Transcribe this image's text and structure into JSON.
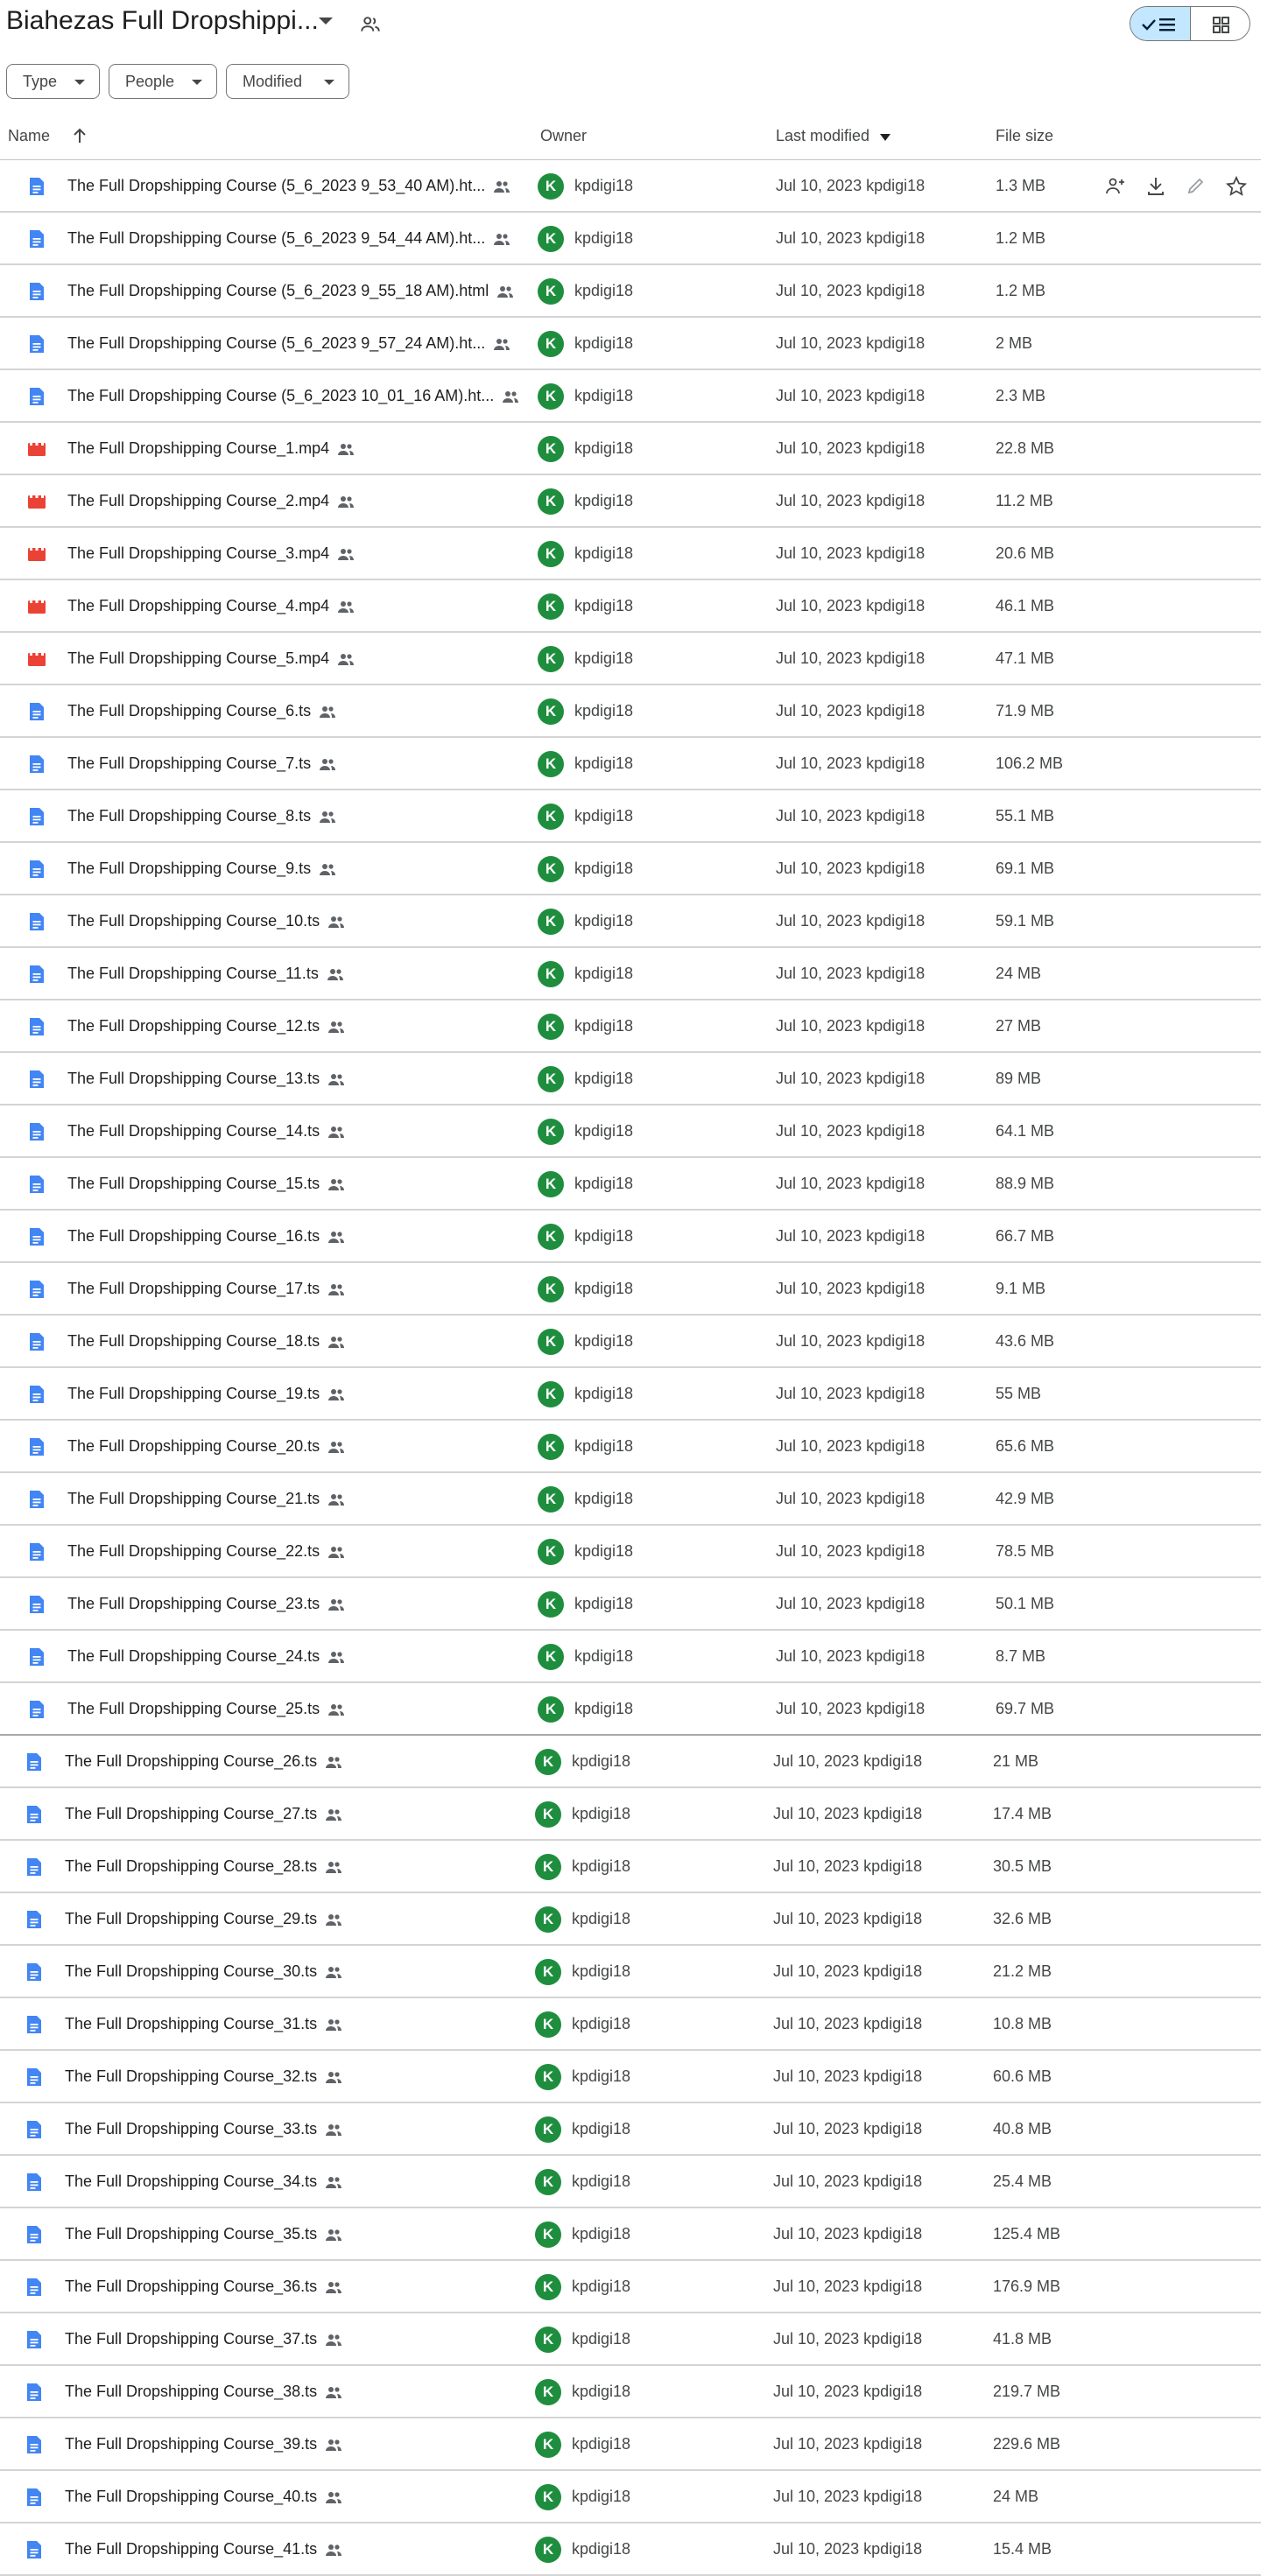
{
  "header": {
    "title": "Biahezas Full Dropshippi...",
    "icons": {
      "title_menu": "chevron-down-icon",
      "shared": "people-icon",
      "list_view": "checkmark-list-icon",
      "grid_view": "grid-icon"
    }
  },
  "filters": [
    {
      "label": "Type"
    },
    {
      "label": "People"
    },
    {
      "label": "Modified"
    }
  ],
  "columns": {
    "name": "Name",
    "owner": "Owner",
    "last_modified": "Last modified",
    "file_size": "File size",
    "sort_icon": "arrow-up-icon",
    "sort_caret": "caret-down-icon"
  },
  "row_actions": [
    "share-add-icon",
    "download-icon",
    "rename-icon",
    "star-icon"
  ],
  "colors": {
    "doc_icon": "#4285f4",
    "video_icon": "#ea4335",
    "avatar": "#1e8e3e",
    "selected_toggle": "#c2e7ff"
  },
  "files": [
    {
      "name": "The Full Dropshipping Course (5_6_2023 9_53_40 AM).ht...",
      "type": "doc",
      "avatar": "K",
      "owner": "kpdigi18",
      "modified": "Jul 10, 2023 kpdigi18",
      "size": "1.3 MB"
    },
    {
      "name": "The Full Dropshipping Course (5_6_2023 9_54_44 AM).ht...",
      "type": "doc",
      "avatar": "K",
      "owner": "kpdigi18",
      "modified": "Jul 10, 2023 kpdigi18",
      "size": "1.2 MB"
    },
    {
      "name": "The Full Dropshipping Course (5_6_2023 9_55_18 AM).html",
      "type": "doc",
      "avatar": "K",
      "owner": "kpdigi18",
      "modified": "Jul 10, 2023 kpdigi18",
      "size": "1.2 MB"
    },
    {
      "name": "The Full Dropshipping Course (5_6_2023 9_57_24 AM).ht...",
      "type": "doc",
      "avatar": "K",
      "owner": "kpdigi18",
      "modified": "Jul 10, 2023 kpdigi18",
      "size": "2 MB"
    },
    {
      "name": "The Full Dropshipping Course (5_6_2023 10_01_16 AM).ht...",
      "type": "doc",
      "avatar": "K",
      "owner": "kpdigi18",
      "modified": "Jul 10, 2023 kpdigi18",
      "size": "2.3 MB"
    },
    {
      "name": "The Full Dropshipping Course_1.mp4",
      "type": "video",
      "avatar": "K",
      "owner": "kpdigi18",
      "modified": "Jul 10, 2023 kpdigi18",
      "size": "22.8 MB"
    },
    {
      "name": "The Full Dropshipping Course_2.mp4",
      "type": "video",
      "avatar": "K",
      "owner": "kpdigi18",
      "modified": "Jul 10, 2023 kpdigi18",
      "size": "11.2 MB"
    },
    {
      "name": "The Full Dropshipping Course_3.mp4",
      "type": "video",
      "avatar": "K",
      "owner": "kpdigi18",
      "modified": "Jul 10, 2023 kpdigi18",
      "size": "20.6 MB"
    },
    {
      "name": "The Full Dropshipping Course_4.mp4",
      "type": "video",
      "avatar": "K",
      "owner": "kpdigi18",
      "modified": "Jul 10, 2023 kpdigi18",
      "size": "46.1 MB"
    },
    {
      "name": "The Full Dropshipping Course_5.mp4",
      "type": "video",
      "avatar": "K",
      "owner": "kpdigi18",
      "modified": "Jul 10, 2023 kpdigi18",
      "size": "47.1 MB"
    },
    {
      "name": "The Full Dropshipping Course_6.ts",
      "type": "doc",
      "avatar": "K",
      "owner": "kpdigi18",
      "modified": "Jul 10, 2023 kpdigi18",
      "size": "71.9 MB"
    },
    {
      "name": "The Full Dropshipping Course_7.ts",
      "type": "doc",
      "avatar": "K",
      "owner": "kpdigi18",
      "modified": "Jul 10, 2023 kpdigi18",
      "size": "106.2 MB"
    },
    {
      "name": "The Full Dropshipping Course_8.ts",
      "type": "doc",
      "avatar": "K",
      "owner": "kpdigi18",
      "modified": "Jul 10, 2023 kpdigi18",
      "size": "55.1 MB"
    },
    {
      "name": "The Full Dropshipping Course_9.ts",
      "type": "doc",
      "avatar": "K",
      "owner": "kpdigi18",
      "modified": "Jul 10, 2023 kpdigi18",
      "size": "69.1 MB"
    },
    {
      "name": "The Full Dropshipping Course_10.ts",
      "type": "doc",
      "avatar": "K",
      "owner": "kpdigi18",
      "modified": "Jul 10, 2023 kpdigi18",
      "size": "59.1 MB"
    },
    {
      "name": "The Full Dropshipping Course_11.ts",
      "type": "doc",
      "avatar": "K",
      "owner": "kpdigi18",
      "modified": "Jul 10, 2023 kpdigi18",
      "size": "24 MB"
    },
    {
      "name": "The Full Dropshipping Course_12.ts",
      "type": "doc",
      "avatar": "K",
      "owner": "kpdigi18",
      "modified": "Jul 10, 2023 kpdigi18",
      "size": "27 MB"
    },
    {
      "name": "The Full Dropshipping Course_13.ts",
      "type": "doc",
      "avatar": "K",
      "owner": "kpdigi18",
      "modified": "Jul 10, 2023 kpdigi18",
      "size": "89 MB"
    },
    {
      "name": "The Full Dropshipping Course_14.ts",
      "type": "doc",
      "avatar": "K",
      "owner": "kpdigi18",
      "modified": "Jul 10, 2023 kpdigi18",
      "size": "64.1 MB"
    },
    {
      "name": "The Full Dropshipping Course_15.ts",
      "type": "doc",
      "avatar": "K",
      "owner": "kpdigi18",
      "modified": "Jul 10, 2023 kpdigi18",
      "size": "88.9 MB"
    },
    {
      "name": "The Full Dropshipping Course_16.ts",
      "type": "doc",
      "avatar": "K",
      "owner": "kpdigi18",
      "modified": "Jul 10, 2023 kpdigi18",
      "size": "66.7 MB"
    },
    {
      "name": "The Full Dropshipping Course_17.ts",
      "type": "doc",
      "avatar": "K",
      "owner": "kpdigi18",
      "modified": "Jul 10, 2023 kpdigi18",
      "size": "9.1 MB"
    },
    {
      "name": "The Full Dropshipping Course_18.ts",
      "type": "doc",
      "avatar": "K",
      "owner": "kpdigi18",
      "modified": "Jul 10, 2023 kpdigi18",
      "size": "43.6 MB"
    },
    {
      "name": "The Full Dropshipping Course_19.ts",
      "type": "doc",
      "avatar": "K",
      "owner": "kpdigi18",
      "modified": "Jul 10, 2023 kpdigi18",
      "size": "55 MB"
    },
    {
      "name": "The Full Dropshipping Course_20.ts",
      "type": "doc",
      "avatar": "K",
      "owner": "kpdigi18",
      "modified": "Jul 10, 2023 kpdigi18",
      "size": "65.6 MB"
    },
    {
      "name": "The Full Dropshipping Course_21.ts",
      "type": "doc",
      "avatar": "K",
      "owner": "kpdigi18",
      "modified": "Jul 10, 2023 kpdigi18",
      "size": "42.9 MB"
    },
    {
      "name": "The Full Dropshipping Course_22.ts",
      "type": "doc",
      "avatar": "K",
      "owner": "kpdigi18",
      "modified": "Jul 10, 2023 kpdigi18",
      "size": "78.5 MB"
    },
    {
      "name": "The Full Dropshipping Course_23.ts",
      "type": "doc",
      "avatar": "K",
      "owner": "kpdigi18",
      "modified": "Jul 10, 2023 kpdigi18",
      "size": "50.1 MB"
    },
    {
      "name": "The Full Dropshipping Course_24.ts",
      "type": "doc",
      "avatar": "K",
      "owner": "kpdigi18",
      "modified": "Jul 10, 2023 kpdigi18",
      "size": "8.7 MB"
    },
    {
      "name": "The Full Dropshipping Course_25.ts",
      "type": "doc",
      "avatar": "K",
      "owner": "kpdigi18",
      "modified": "Jul 10, 2023 kpdigi18",
      "size": "69.7 MB"
    },
    {
      "name": "The Full Dropshipping Course_26.ts",
      "type": "doc",
      "avatar": "K",
      "owner": "kpdigi18",
      "modified": "Jul 10, 2023 kpdigi18",
      "size": "21 MB"
    },
    {
      "name": "The Full Dropshipping Course_27.ts",
      "type": "doc",
      "avatar": "K",
      "owner": "kpdigi18",
      "modified": "Jul 10, 2023 kpdigi18",
      "size": "17.4 MB"
    },
    {
      "name": "The Full Dropshipping Course_28.ts",
      "type": "doc",
      "avatar": "K",
      "owner": "kpdigi18",
      "modified": "Jul 10, 2023 kpdigi18",
      "size": "30.5 MB"
    },
    {
      "name": "The Full Dropshipping Course_29.ts",
      "type": "doc",
      "avatar": "K",
      "owner": "kpdigi18",
      "modified": "Jul 10, 2023 kpdigi18",
      "size": "32.6 MB"
    },
    {
      "name": "The Full Dropshipping Course_30.ts",
      "type": "doc",
      "avatar": "K",
      "owner": "kpdigi18",
      "modified": "Jul 10, 2023 kpdigi18",
      "size": "21.2 MB"
    },
    {
      "name": "The Full Dropshipping Course_31.ts",
      "type": "doc",
      "avatar": "K",
      "owner": "kpdigi18",
      "modified": "Jul 10, 2023 kpdigi18",
      "size": "10.8 MB"
    },
    {
      "name": "The Full Dropshipping Course_32.ts",
      "type": "doc",
      "avatar": "K",
      "owner": "kpdigi18",
      "modified": "Jul 10, 2023 kpdigi18",
      "size": "60.6 MB"
    },
    {
      "name": "The Full Dropshipping Course_33.ts",
      "type": "doc",
      "avatar": "K",
      "owner": "kpdigi18",
      "modified": "Jul 10, 2023 kpdigi18",
      "size": "40.8 MB"
    },
    {
      "name": "The Full Dropshipping Course_34.ts",
      "type": "doc",
      "avatar": "K",
      "owner": "kpdigi18",
      "modified": "Jul 10, 2023 kpdigi18",
      "size": "25.4 MB"
    },
    {
      "name": "The Full Dropshipping Course_35.ts",
      "type": "doc",
      "avatar": "K",
      "owner": "kpdigi18",
      "modified": "Jul 10, 2023 kpdigi18",
      "size": "125.4 MB"
    },
    {
      "name": "The Full Dropshipping Course_36.ts",
      "type": "doc",
      "avatar": "K",
      "owner": "kpdigi18",
      "modified": "Jul 10, 2023 kpdigi18",
      "size": "176.9 MB"
    },
    {
      "name": "The Full Dropshipping Course_37.ts",
      "type": "doc",
      "avatar": "K",
      "owner": "kpdigi18",
      "modified": "Jul 10, 2023 kpdigi18",
      "size": "41.8 MB"
    },
    {
      "name": "The Full Dropshipping Course_38.ts",
      "type": "doc",
      "avatar": "K",
      "owner": "kpdigi18",
      "modified": "Jul 10, 2023 kpdigi18",
      "size": "219.7 MB"
    },
    {
      "name": "The Full Dropshipping Course_39.ts",
      "type": "doc",
      "avatar": "K",
      "owner": "kpdigi18",
      "modified": "Jul 10, 2023 kpdigi18",
      "size": "229.6 MB"
    },
    {
      "name": "The Full Dropshipping Course_40.ts",
      "type": "doc",
      "avatar": "K",
      "owner": "kpdigi18",
      "modified": "Jul 10, 2023 kpdigi18",
      "size": "24 MB"
    },
    {
      "name": "The Full Dropshipping Course_41.ts",
      "type": "doc",
      "avatar": "K",
      "owner": "kpdigi18",
      "modified": "Jul 10, 2023 kpdigi18",
      "size": "15.4 MB"
    }
  ]
}
